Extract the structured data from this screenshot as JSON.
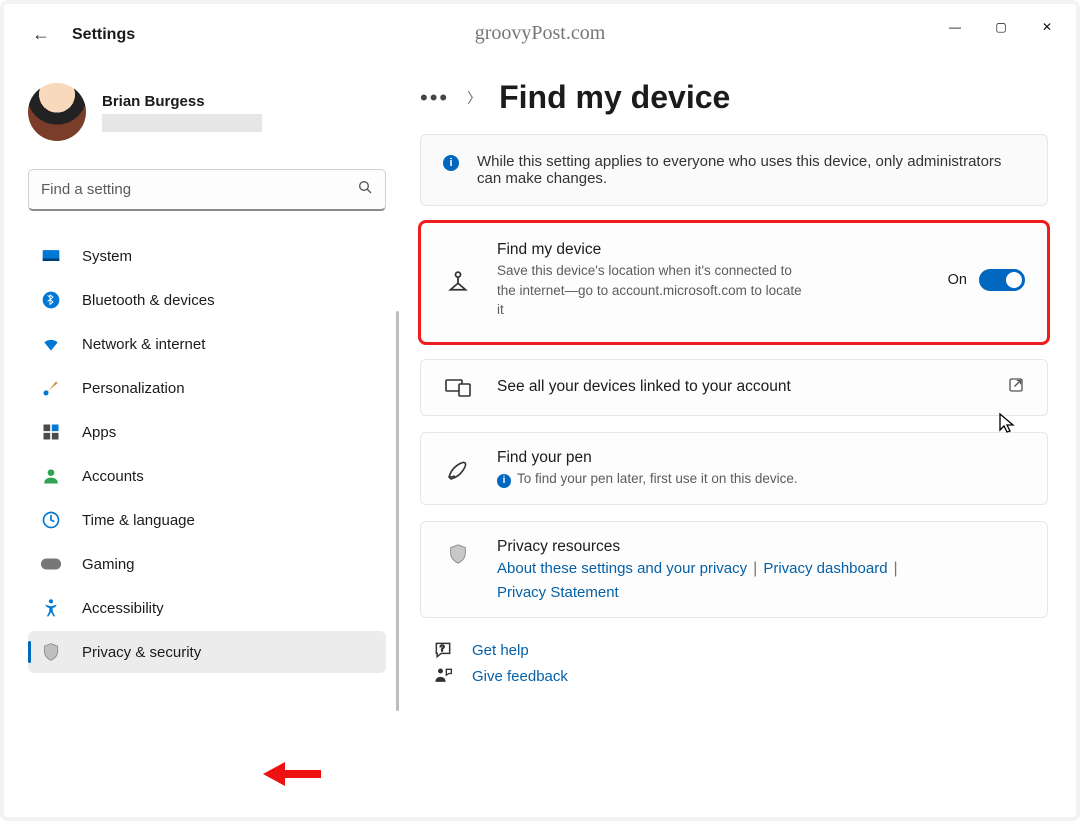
{
  "watermark": "groovyPost.com",
  "header": {
    "app_title": "Settings"
  },
  "window_controls": {
    "min": "—",
    "max": "▢",
    "close": "✕"
  },
  "profile": {
    "name": "Brian Burgess"
  },
  "search": {
    "placeholder": "Find a setting"
  },
  "sidebar": {
    "items": [
      {
        "label": "System"
      },
      {
        "label": "Bluetooth & devices"
      },
      {
        "label": "Network & internet"
      },
      {
        "label": "Personalization"
      },
      {
        "label": "Apps"
      },
      {
        "label": "Accounts"
      },
      {
        "label": "Time & language"
      },
      {
        "label": "Gaming"
      },
      {
        "label": "Accessibility"
      },
      {
        "label": "Privacy & security"
      }
    ]
  },
  "breadcrumb": {
    "title": "Find my device"
  },
  "banner": {
    "text": "While this setting applies to everyone who uses this device, only administrators can make changes."
  },
  "cards": {
    "find_device": {
      "title": "Find my device",
      "desc": "Save this device's location when it's connected to the internet—go to account.microsoft.com to locate it",
      "toggle_label": "On"
    },
    "linked": {
      "title": "See all your devices linked to your account"
    },
    "pen": {
      "title": "Find your pen",
      "desc": "To find your pen later, first use it on this device."
    },
    "privacy": {
      "title": "Privacy resources",
      "links": [
        "About these settings and your privacy",
        "Privacy dashboard",
        "Privacy Statement"
      ]
    }
  },
  "help": {
    "get_help": "Get help",
    "give_feedback": "Give feedback"
  }
}
